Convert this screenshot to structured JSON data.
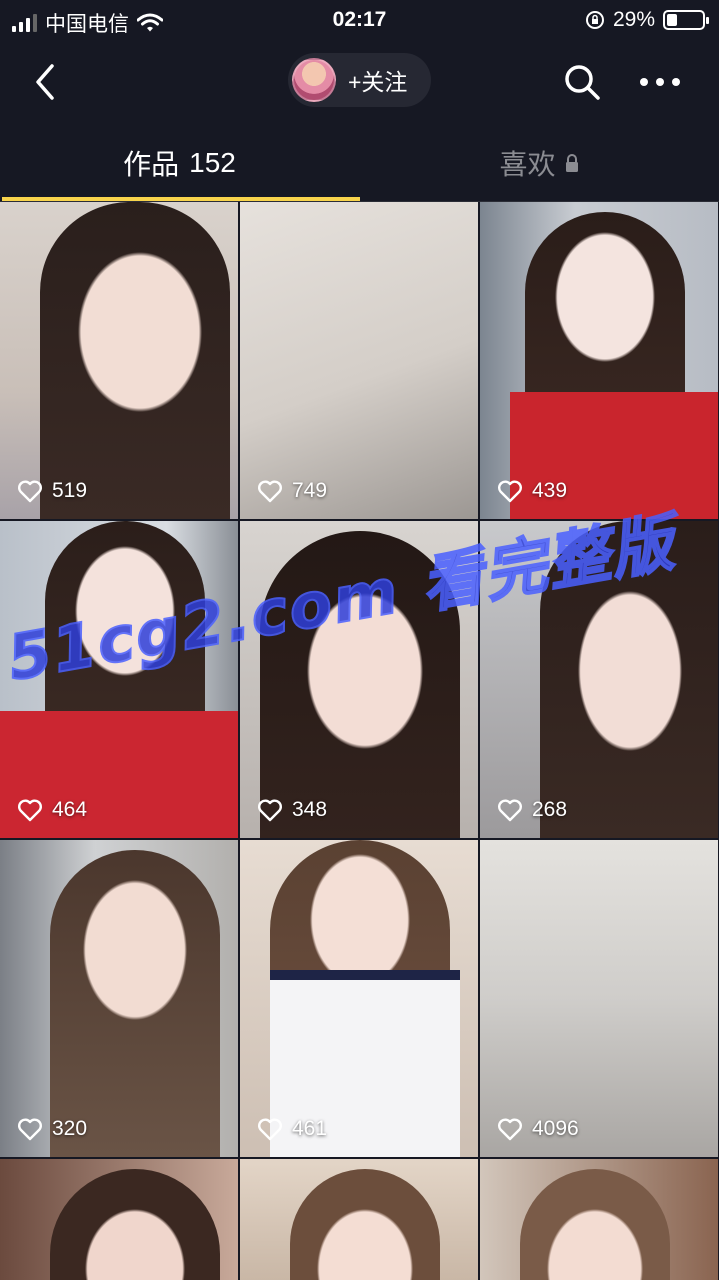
{
  "status_bar": {
    "carrier": "中国电信",
    "time": "02:17",
    "battery_percent": "29%",
    "battery_level": 0.29,
    "icons": [
      "signal-icon",
      "wifi-icon",
      "rotation-lock-icon",
      "battery-icon"
    ]
  },
  "nav": {
    "back_icon": "chevron-left-icon",
    "follow_label": "+关注",
    "search_icon": "search-icon",
    "more_icon": "more-icon"
  },
  "tabs": {
    "works_label": "作品",
    "works_count": "152",
    "likes_label": "喜欢",
    "accent_color": "#f8d44c"
  },
  "videos": [
    {
      "likes": "519"
    },
    {
      "likes": "749"
    },
    {
      "likes": "439"
    },
    {
      "likes": "464"
    },
    {
      "likes": "348"
    },
    {
      "likes": "268"
    },
    {
      "likes": "320"
    },
    {
      "likes": "461"
    },
    {
      "likes": "4096"
    },
    {
      "likes": ""
    },
    {
      "likes": ""
    },
    {
      "likes": ""
    }
  ],
  "watermark": "51cg2.com 看完整版"
}
